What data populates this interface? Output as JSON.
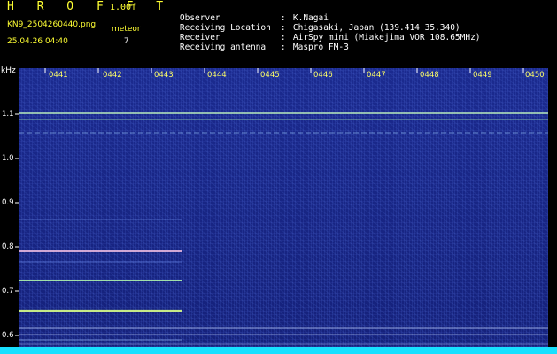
{
  "header": {
    "app_title": "H R O F F T",
    "version": "1.00f",
    "filename": "KN9_2504260440.png",
    "timestamp": "25.04.26 04:40",
    "meteor_label": "meteor",
    "meteor_count": "7",
    "info": [
      {
        "label": "Observer",
        "sep": ":",
        "value": "K.Nagai"
      },
      {
        "label": "Receiving Location",
        "sep": ":",
        "value": "Chigasaki, Japan (139.414 35.340)"
      },
      {
        "label": "Receiver",
        "sep": ":",
        "value": "AirSpy mini (Miakejima VOR 108.65MHz)"
      },
      {
        "label": "Receiving antenna",
        "sep": ":",
        "value": "Maspro FM-3"
      }
    ]
  },
  "spectrogram": {
    "unit": "kHz",
    "y_labels": [
      "1.1",
      "1.0",
      "0.9",
      "0.8",
      "0.7",
      "0.6"
    ],
    "x_labels": [
      "0441",
      "0442",
      "0443",
      "0444",
      "0445",
      "0446",
      "0447",
      "0448",
      "0449",
      "0450"
    ],
    "colors": {
      "background": "#1b2a8f",
      "signal": "#b8ffb0",
      "strong_signal": "#ffd0e8",
      "baseline": "#18e0ff",
      "label_yellow": "#ffff66"
    }
  }
}
